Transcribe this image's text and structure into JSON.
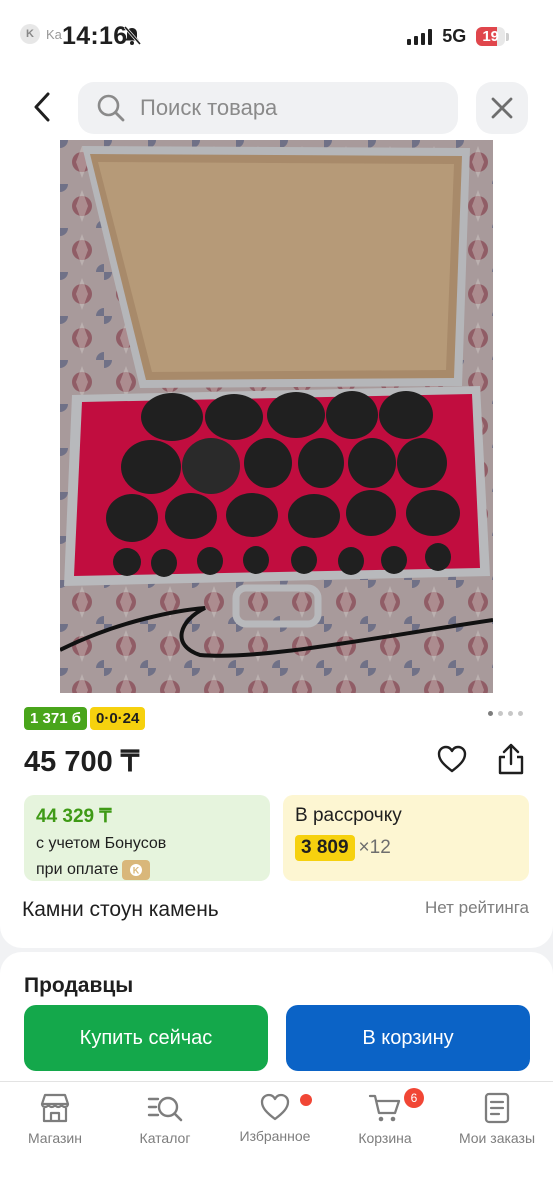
{
  "status_bar": {
    "carrier": "Ka",
    "time": "14:16",
    "network": "5G",
    "battery": "19"
  },
  "header": {
    "search_placeholder": "Поиск товара"
  },
  "product": {
    "image_count": 4,
    "active_image": 1,
    "badges": [
      "1 371 б",
      "0·0·24"
    ],
    "price": "45 700 ₸",
    "bonus": {
      "amount": "44 329 ₸",
      "line1": "с учетом Бонусов",
      "line2": "при оплате"
    },
    "installment": {
      "label": "В рассрочку",
      "monthly": "3 809",
      "months": "×12"
    },
    "title": "Камни стоун камень",
    "rating": "Нет рейтинга"
  },
  "sellers": {
    "heading": "Продавцы"
  },
  "actions": {
    "buy_now": "Купить сейчас",
    "add_to_cart": "В корзину"
  },
  "bottom_nav": {
    "shop": "Магазин",
    "catalog": "Каталог",
    "favorites": "Избранное",
    "cart": "Корзина",
    "cart_count": "6",
    "orders": "Мои заказы"
  },
  "colors": {
    "brand_red": "#f14635",
    "buy_green": "#14a84b",
    "cart_blue": "#0b63c6",
    "bonus_green": "#49a51b",
    "installment_yellow": "#f6d10e"
  }
}
